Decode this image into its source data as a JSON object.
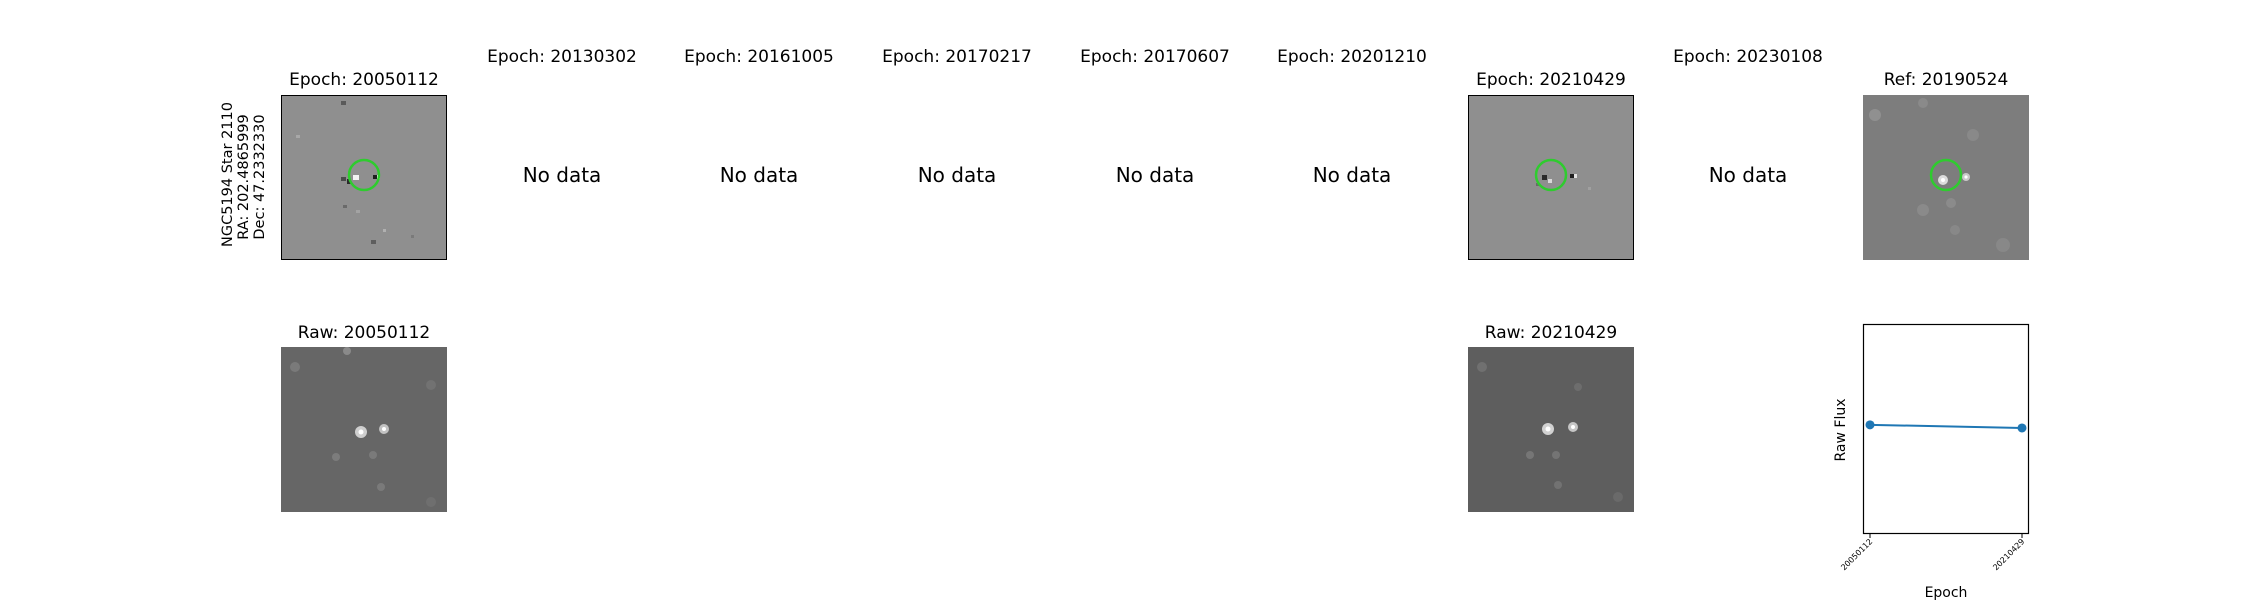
{
  "row_label": {
    "line1": "NGC5194 Star 2110",
    "line2": "RA: 202.4865999",
    "line3": "Dec: 47.2332330"
  },
  "epoch_titles": [
    "Epoch: 20050112",
    "Epoch: 20130302",
    "Epoch: 20161005",
    "Epoch: 20170217",
    "Epoch: 20170607",
    "Epoch: 20201210",
    "Epoch: 20210429",
    "Epoch: 20230108"
  ],
  "ref_title": "Ref: 20190524",
  "no_data_label": "No data",
  "raw_titles": [
    "Raw: 20050112",
    "Raw: 20210429"
  ],
  "chart_data": {
    "type": "line",
    "categories": [
      "20050112",
      "20210429"
    ],
    "series": [
      {
        "values": [
          0.52,
          0.505
        ]
      }
    ],
    "xlabel": "Epoch",
    "ylabel": "Raw Flux",
    "ylim": [
      0,
      1
    ],
    "grid": false,
    "color": "#1f77b4"
  }
}
